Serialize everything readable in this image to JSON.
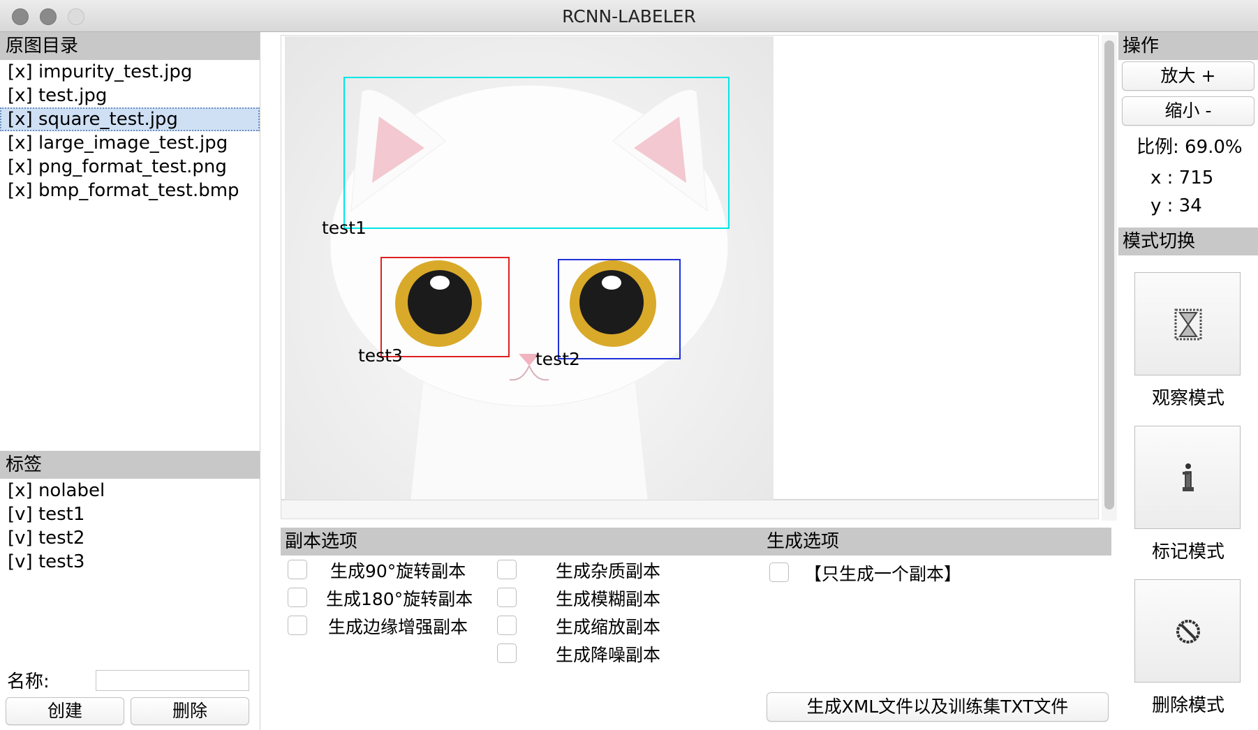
{
  "window": {
    "title": "RCNN-LABELER"
  },
  "left": {
    "files_header": "原图目录",
    "files": [
      "[x] impurity_test.jpg",
      "[x] test.jpg",
      "[x] square_test.jpg",
      "[x] large_image_test.jpg",
      "[x] png_format_test.png",
      "[x] bmp_format_test.bmp"
    ],
    "labels_header": "标签",
    "labels": [
      "[x] nolabel",
      "[v] test1",
      "[v] test2",
      "[v] test3"
    ],
    "name_label": "名称:",
    "name_value": "",
    "create_label": "创建",
    "delete_label": "删除"
  },
  "canvas": {
    "boxes": [
      {
        "label": "test1",
        "color": "#00e5e5"
      },
      {
        "label": "test3",
        "color": "#e02020"
      },
      {
        "label": "test2",
        "color": "#2030d8"
      }
    ]
  },
  "options": {
    "copy_header": "副本选项",
    "copy_items": [
      "生成90°旋转副本",
      "生成180°旋转副本",
      "生成边缘增强副本",
      "生成杂质副本",
      "生成模糊副本",
      "生成缩放副本",
      "生成降噪副本"
    ],
    "gen_header": "生成选项",
    "gen_items": [
      "【只生成一个副本】"
    ],
    "gen_button": "生成XML文件以及训练集TXT文件"
  },
  "right": {
    "ops_header": "操作",
    "zoom_in": "放大 +",
    "zoom_out": "缩小 -",
    "scale_text": "比例: 69.0%",
    "x_text": "x : 715",
    "y_text": "y : 34",
    "mode_header": "模式切换",
    "modes": [
      {
        "label": "观察模式",
        "icon": "hourglass-icon"
      },
      {
        "label": "标记模式",
        "icon": "ibeam-icon"
      },
      {
        "label": "删除模式",
        "icon": "forbidden-icon"
      }
    ]
  }
}
